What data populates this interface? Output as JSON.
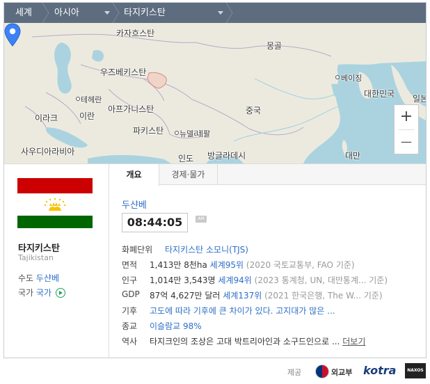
{
  "breadcrumb": {
    "world": "세계",
    "region": "아시아",
    "country": "타지키스탄"
  },
  "map": {
    "places": [
      "카자흐스탄",
      "몽골",
      "우즈베키스탄",
      "베이징",
      "대한민국",
      "테헤란",
      "이라크",
      "이란",
      "아프가니스탄",
      "중국",
      "파키스탄",
      "뉴델리",
      "네팔",
      "사우디아라비아",
      "인도",
      "방글라데시",
      "대만",
      "일본"
    ],
    "zoom_in": "+",
    "zoom_out": "—"
  },
  "country": {
    "name_ko": "타지키스탄",
    "name_en": "Tajikistan",
    "capital_label": "수도",
    "capital": "두샨베",
    "anthem_label": "국가",
    "anthem": "국가"
  },
  "tabs": [
    "개요",
    "경제·물가"
  ],
  "overview": {
    "capital_link": "두샨베",
    "time": "08:44:05",
    "ampm": "AM",
    "rows": [
      {
        "key": "화폐단위",
        "value": "",
        "link": "타지키스탄 소모니(TJS)",
        "source": ""
      },
      {
        "key": "면적",
        "value": "1,413만 8천ha",
        "link": "세계95위",
        "source": "(2020 국토교통부, FAO 기준)"
      },
      {
        "key": "인구",
        "value": "1,014만 3,543명",
        "link": "세계94위",
        "source": "(2023 통계청, UN, 대만통계...  기준)"
      },
      {
        "key": "GDP",
        "value": "87억 4,627만 달러",
        "link": "세계137위",
        "source": "(2021 한국은행, The W...  기준)"
      },
      {
        "key": "기후",
        "value": "",
        "link": "고도에 따라 기후에 큰 차이가 있다. 고지대가 많은 ...",
        "source": ""
      },
      {
        "key": "종교",
        "value": "",
        "link": "이슬람교 98%",
        "source": ""
      },
      {
        "key": "역사",
        "value": "타지크인의 조상은 고대 박트리아인과 소구드인으로 ...",
        "link": "",
        "source": "",
        "more": "더보기"
      }
    ]
  },
  "footer": {
    "provided_by": "제공",
    "mofa": "외교부",
    "kotra": "kotra",
    "naxos": "NAXOS"
  },
  "colors": {
    "breadcrumb_bg": "#5d6d7f",
    "link": "#2d6fc7",
    "pin": "#3b82f6",
    "flag_red": "#cc0000",
    "flag_green": "#006600"
  }
}
